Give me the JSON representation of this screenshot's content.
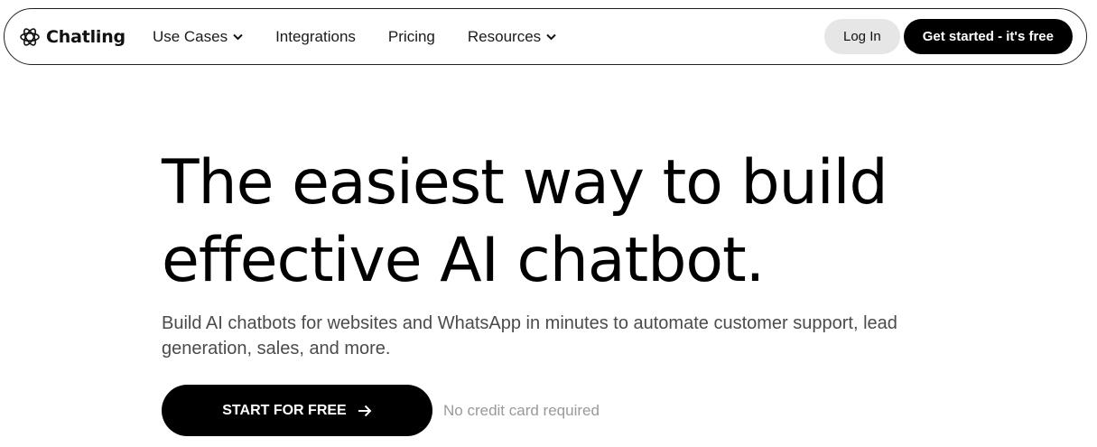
{
  "nav": {
    "brand": "Chatling",
    "links": [
      {
        "label": "Use Cases",
        "dropdown": true
      },
      {
        "label": "Integrations",
        "dropdown": false
      },
      {
        "label": "Pricing",
        "dropdown": false
      },
      {
        "label": "Resources",
        "dropdown": true
      }
    ],
    "login_label": "Log In",
    "cta_label": "Get started - it's free"
  },
  "hero": {
    "title_line1": "The easiest way to build",
    "title_line2": "effective AI chatbot.",
    "subtitle": "Build AI chatbots for websites and WhatsApp in minutes to automate customer support, lead generation, sales, and more.",
    "start_label": "START FOR FREE",
    "note": "No credit card required"
  },
  "icons": {
    "brand": "atom-logo-icon",
    "dropdown": "chevron-down-icon",
    "start": "arrow-right-icon"
  },
  "colors": {
    "primary": "#000000",
    "secondary_button": "#e6e6e6",
    "subtitle_text": "#4b4b4b",
    "muted_text": "#9a9a9a"
  }
}
